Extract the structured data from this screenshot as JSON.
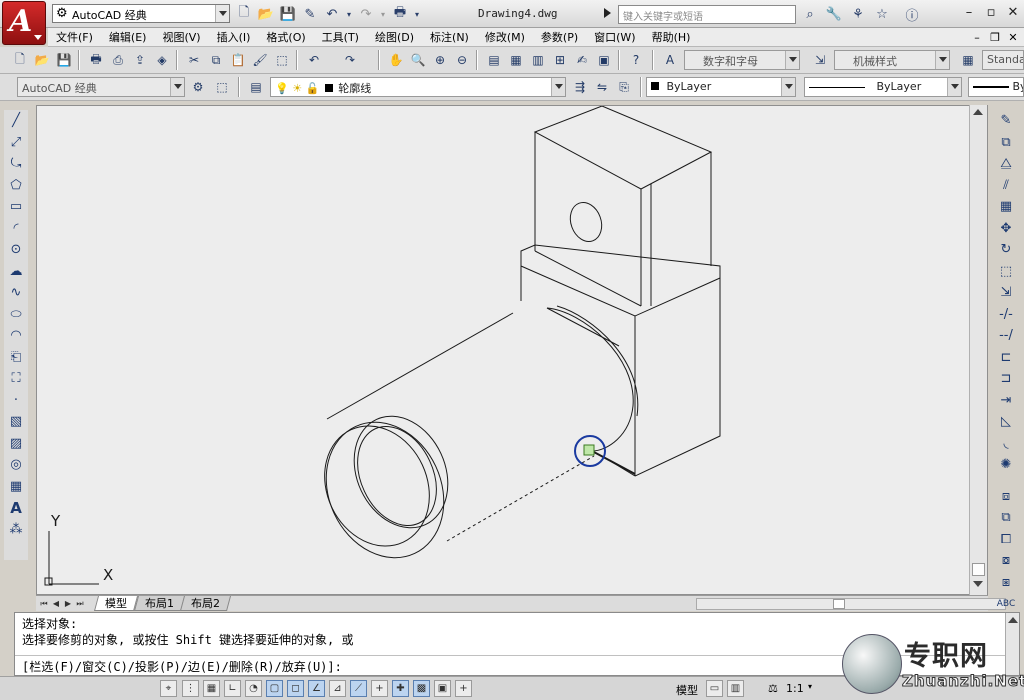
{
  "app": {
    "logo_letter": "A",
    "workspace": "AutoCAD 经典",
    "document_title": "Drawing4.dwg",
    "search_placeholder": "键入关键字或短语"
  },
  "menu": [
    "文件(F)",
    "编辑(E)",
    "视图(V)",
    "插入(I)",
    "格式(O)",
    "工具(T)",
    "绘图(D)",
    "标注(N)",
    "修改(M)",
    "参数(P)",
    "窗口(W)",
    "帮助(H)"
  ],
  "styles": {
    "text_style": "数字和字母",
    "dim_style": "机械样式",
    "table_style": "Standa"
  },
  "layers": {
    "workspace_combo": "AutoCAD 经典",
    "current_layer": "轮廓线",
    "color": "ByLayer",
    "linetype": "ByLayer",
    "lineweight": "ByLayer"
  },
  "ucs": {
    "x_label": "X",
    "y_label": "Y"
  },
  "layout_tabs": [
    "模型",
    "布局1",
    "布局2"
  ],
  "command_history": [
    "选择对象:",
    "选择要修剪的对象, 或按住 Shift 键选择要延伸的对象, 或",
    "[栏选(F)/窗交(C)/投影(P)/边(E)/删除(R)/放弃(U)]:"
  ],
  "status": {
    "model_label": "模型",
    "scale": "1:1"
  },
  "watermark": {
    "brand": "专职网",
    "url": "Zhuanzhi.Net"
  },
  "colors": {
    "canvas_bg": "#ededed",
    "pickbox": "#1a3aa0",
    "logo_red": "#c81e1e"
  }
}
